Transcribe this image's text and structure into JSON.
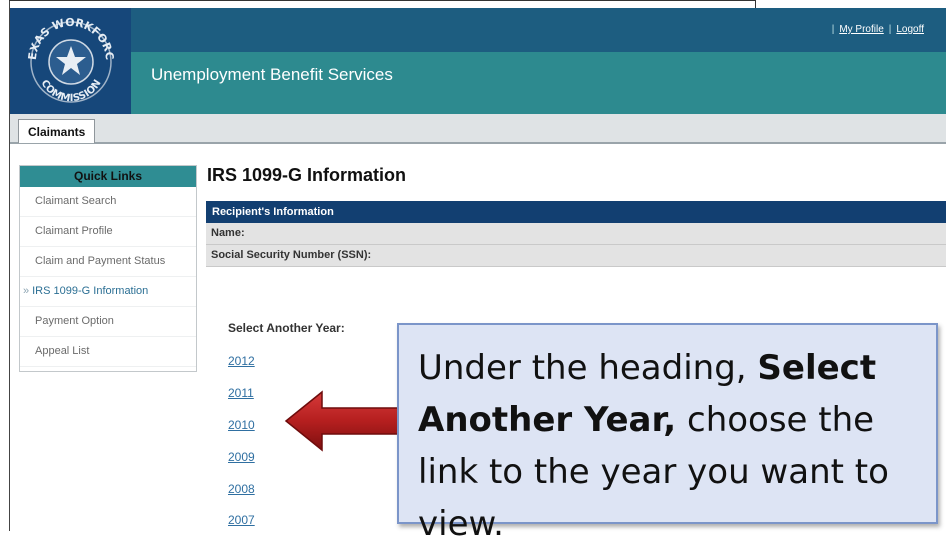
{
  "header": {
    "app_title": "Unemployment Benefit Services",
    "logo_text_top": "TEXAS WORKFORCE",
    "logo_text_bottom": "COMMISSION",
    "links": {
      "my_profile": "My Profile",
      "logoff": "Logoff"
    }
  },
  "tabs": {
    "claimants": "Claimants"
  },
  "quick_links": {
    "title": "Quick Links",
    "items": [
      {
        "label": "Claimant Search"
      },
      {
        "label": "Claimant Profile"
      },
      {
        "label": "Claim and Payment Status"
      },
      {
        "label": "IRS 1099-G Information",
        "active": true
      },
      {
        "label": "Payment Option"
      },
      {
        "label": "Appeal List"
      }
    ]
  },
  "main": {
    "title": "IRS 1099-G Information",
    "recipient": {
      "header": "Recipient's Information",
      "name_label": "Name:",
      "ssn_label": "Social Security Number (SSN):"
    },
    "select_year_label": "Select Another Year:",
    "years": [
      "2012",
      "2011",
      "2010",
      "2009",
      "2008",
      "2007"
    ]
  },
  "callout": {
    "part1": "Under the heading, ",
    "bold1": "Select Another Year,",
    "part2": " choose the link to the year you want to view."
  },
  "colors": {
    "header_teal": "#2d8a8f",
    "header_dark": "#1d5d80",
    "logo_blue": "#16477a",
    "recipient_header": "#123f71",
    "link_blue": "#2f6fa1",
    "callout_bg": "#dde4f4",
    "arrow_red": "#b51f1f"
  }
}
